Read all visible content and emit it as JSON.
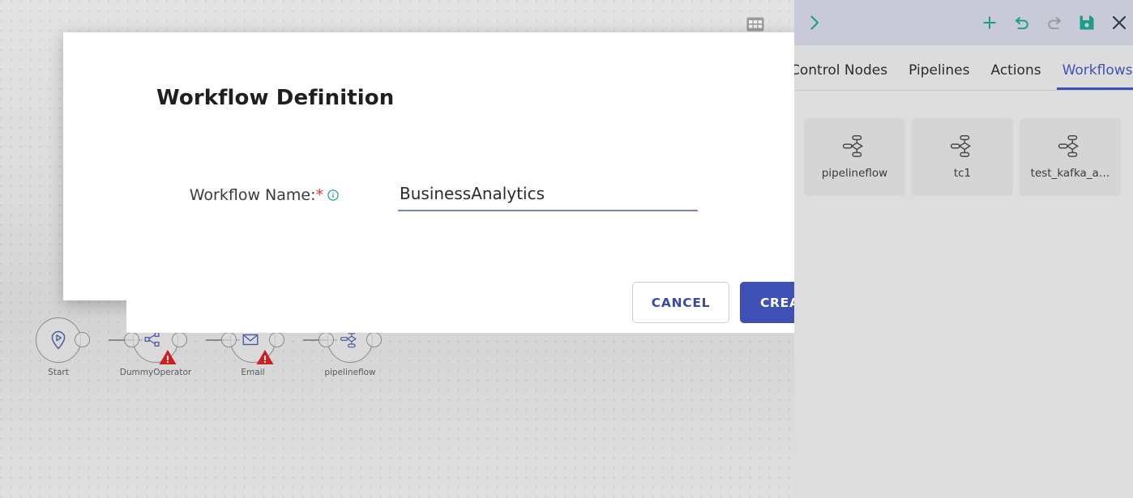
{
  "modal": {
    "title": "Workflow Definition",
    "close_label": "×",
    "field": {
      "label": "Workflow Name:",
      "required_marker": "*",
      "info_icon": "info-icon",
      "value": "BusinessAnalytics",
      "placeholder": ""
    },
    "cancel_label": "CANCEL",
    "create_label": "CREATE"
  },
  "toolbar": {
    "expand_icon": "chevron-right-icon",
    "add_icon": "plus-icon",
    "undo_icon": "undo-icon",
    "redo_icon": "redo-icon",
    "save_icon": "save-icon",
    "close_icon": "close-icon"
  },
  "tabs": [
    {
      "label": "Control Nodes",
      "active": false
    },
    {
      "label": "Pipelines",
      "active": false
    },
    {
      "label": "Actions",
      "active": false
    },
    {
      "label": "Workflows",
      "active": true
    }
  ],
  "cards": [
    {
      "label": "pipelineflow",
      "icon": "pipeline-flow-icon"
    },
    {
      "label": "tc1",
      "icon": "pipeline-flow-icon"
    },
    {
      "label": "test_kafka_a…",
      "icon": "pipeline-flow-icon"
    }
  ],
  "canvas": {
    "grid_icon": "table-grid-icon",
    "nodes": [
      {
        "label": "Start",
        "icon": "start-pin-play-icon",
        "warning": false
      },
      {
        "label": "DummyOperator",
        "icon": "share-nodes-icon",
        "warning": true
      },
      {
        "label": "Email",
        "icon": "envelope-icon",
        "warning": true
      },
      {
        "label": "pipelineflow",
        "icon": "pipeline-flow-icon",
        "warning": false
      }
    ]
  },
  "colors": {
    "accent_indigo": "#3f51b5",
    "accent_teal": "#1d9c8c",
    "required_red": "#e53935",
    "warning_red": "#cc1f1f",
    "node_outline": "#8a8a8a",
    "node_icon_blue": "#4a5aa8",
    "toolbar_bg": "#c9cad8",
    "panel_bg": "#dddddd",
    "card_bg": "#d5d5d5",
    "canvas_bg": "#dcdcdc"
  }
}
